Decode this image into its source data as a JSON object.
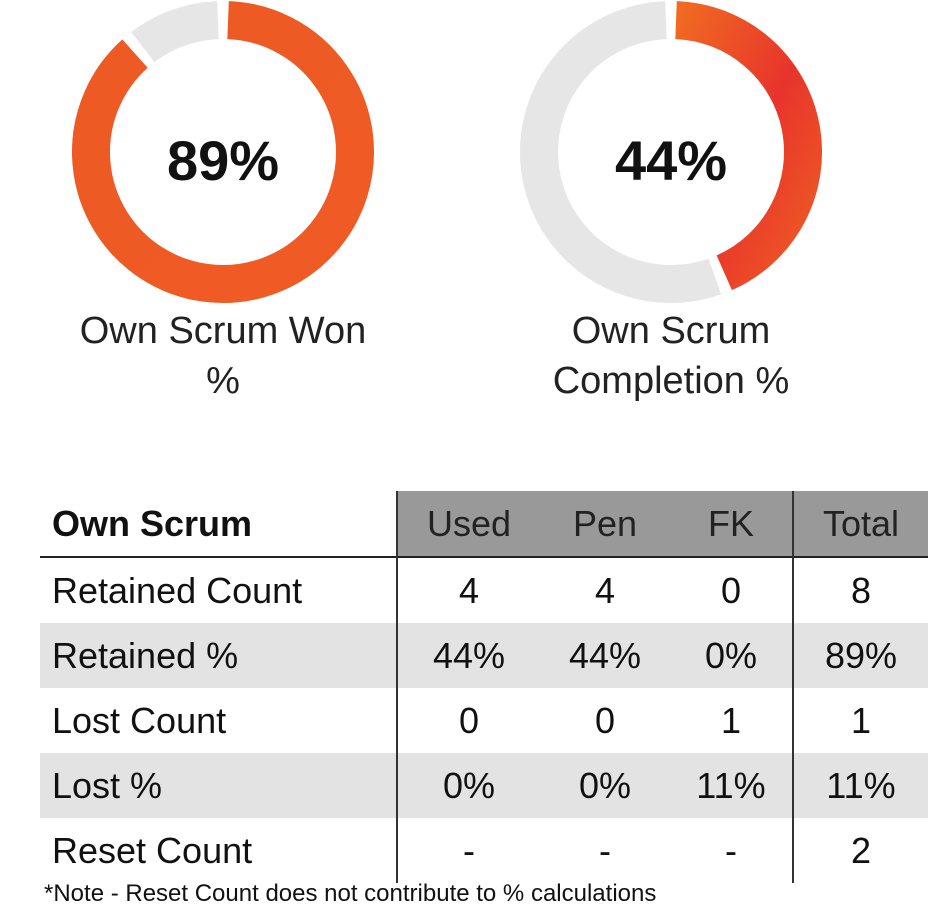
{
  "chart_data": [
    {
      "type": "pie",
      "style": "donut",
      "center_label": "89%",
      "value": 89,
      "remainder": 11,
      "label_line1": "Own Scrum Won",
      "label_line2": "%",
      "fill_color": "#ee5a26",
      "track_color": "#e6e6e6"
    },
    {
      "type": "pie",
      "style": "donut",
      "center_label": "44%",
      "value": 44,
      "remainder": 56,
      "label_line1": "Own Scrum",
      "label_line2": "Completion %",
      "fill_color": "#e8402e",
      "track_color": "#e6e6e6"
    },
    {
      "type": "table",
      "header": {
        "title": "Own Scrum",
        "cols": [
          "Used",
          "Pen",
          "FK",
          "Total"
        ]
      },
      "rows": [
        {
          "label": "Retained Count",
          "values": [
            "4",
            "4",
            "0",
            "8"
          ]
        },
        {
          "label": "Retained %",
          "values": [
            "44%",
            "44%",
            "0%",
            "89%"
          ]
        },
        {
          "label": "Lost Count",
          "values": [
            "0",
            "0",
            "1",
            "1"
          ]
        },
        {
          "label": "Lost %",
          "values": [
            "0%",
            "0%",
            "11%",
            "11%"
          ]
        },
        {
          "label": "Reset Count",
          "values": [
            "-",
            "-",
            "-",
            "2"
          ]
        }
      ],
      "note": "*Note - Reset Count does not contribute to % calculations"
    }
  ]
}
